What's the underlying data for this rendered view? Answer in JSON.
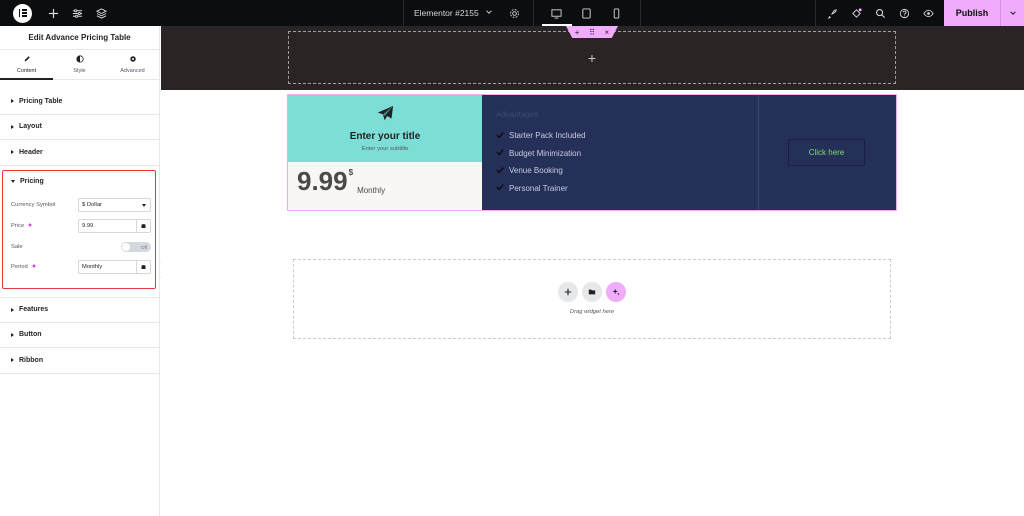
{
  "topbar": {
    "doc_title": "Elementor #2155",
    "publish_label": "Publish"
  },
  "panel": {
    "title": "Edit Advance Pricing Table",
    "tabs": [
      {
        "label": "Content",
        "icon": "pencil-icon",
        "active": true
      },
      {
        "label": "Style",
        "icon": "half-circle-icon",
        "active": false
      },
      {
        "label": "Advanced",
        "icon": "gear-icon",
        "active": false
      }
    ],
    "sections_top": [
      "Pricing Table",
      "Layout",
      "Header"
    ],
    "pricing": {
      "label": "Pricing",
      "currency_label": "Currency Symbol",
      "currency_value": "$ Dollar",
      "price_label": "Price",
      "price_value": "9.99",
      "sale_label": "Sale",
      "sale_state": "Off",
      "period_label": "Period",
      "period_value": "Monthly"
    },
    "sections_bottom": [
      "Features",
      "Button",
      "Ribbon"
    ]
  },
  "pricing_table": {
    "title": "Enter your title",
    "subtitle": "Enter your subtitle",
    "price": "9.99",
    "currency": "$",
    "period": "Monthly",
    "features_heading": "Advantages",
    "features": [
      "Starter Pack Included",
      "Budget Minimization",
      "Venue Booking",
      "Personal Trainer"
    ],
    "button_label": "Click here"
  },
  "drop_area": {
    "label": "Drag widget here"
  },
  "colors": {
    "accent": "#f0abfc",
    "header_bg": "#7cded7",
    "table_bg": "#253059",
    "button_text": "#7ddc6f",
    "highlight_border": "#e33b3b"
  }
}
